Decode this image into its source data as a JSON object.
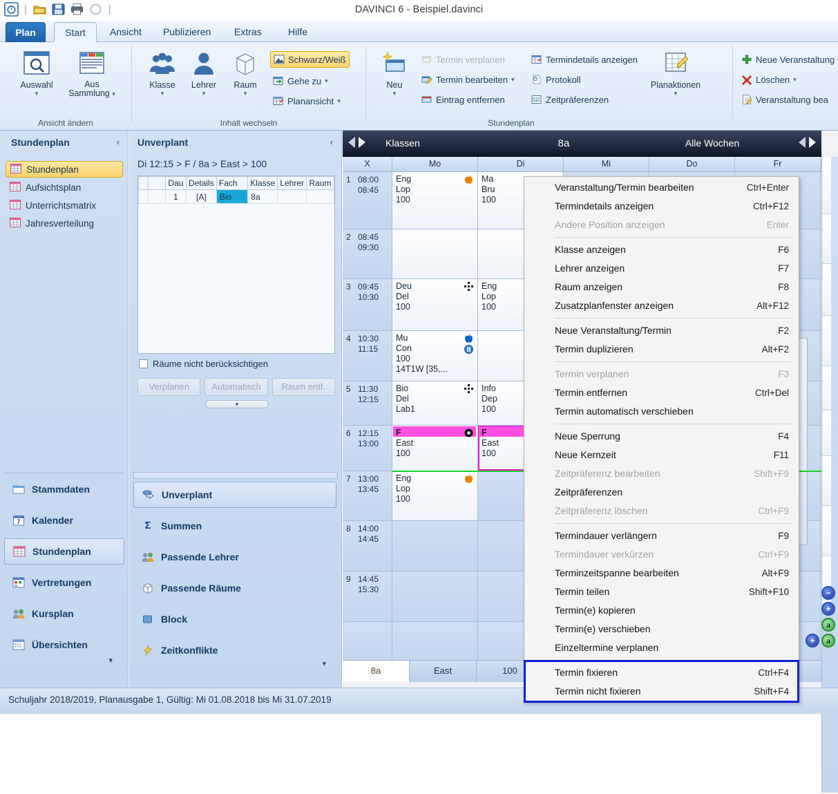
{
  "window": {
    "title": "DAVINCI 6 - Beispiel.davinci",
    "quick_access": [
      {
        "name": "app-icon",
        "icon": "davinci-logo-icon"
      },
      {
        "name": "open",
        "icon": "open-folder-icon"
      },
      {
        "name": "save",
        "icon": "save-disk-icon"
      },
      {
        "name": "print",
        "icon": "printer-icon"
      },
      {
        "name": "refresh",
        "icon": "refresh-icon"
      }
    ]
  },
  "ribbon": {
    "tabs": [
      {
        "label": "Plan",
        "state": "file"
      },
      {
        "label": "Start",
        "state": "active"
      },
      {
        "label": "Ansicht",
        "state": "normal"
      },
      {
        "label": "Publizieren",
        "state": "normal"
      },
      {
        "label": "Extras",
        "state": "normal"
      },
      {
        "label": "Hilfe",
        "state": "normal"
      }
    ],
    "groups": [
      {
        "label": "Ansicht ändern",
        "big_buttons": [
          {
            "label": "Auswahl",
            "icon": "magnifier-window-icon",
            "caret": "▾"
          },
          {
            "label": "Aus\nSammlung",
            "label_l1": "Aus",
            "label_l2": "Sammlung",
            "icon": "collection-table-icon",
            "caret": "▾"
          }
        ]
      },
      {
        "label": "Inhalt wechseln",
        "big_buttons": [
          {
            "label": "Klasse",
            "icon": "people-group-icon",
            "caret": "▾"
          },
          {
            "label": "Lehrer",
            "icon": "person-icon",
            "caret": "▾"
          },
          {
            "label": "Raum",
            "icon": "cube-icon",
            "caret": "▾"
          }
        ],
        "small_buttons": [
          {
            "label": "Schwarz/Weiß",
            "icon": "blackwhite-icon",
            "state": "highlight"
          },
          {
            "label": "Gehe zu",
            "icon": "goto-calendar-icon",
            "caret": "▾"
          },
          {
            "label": "Planansicht",
            "icon": "plan-view-icon",
            "caret": "▾"
          }
        ]
      },
      {
        "label": "Stundenplan",
        "big_buttons": [
          {
            "label": "Neu",
            "icon": "new-star-icon",
            "caret": "▾"
          },
          {
            "label": "Planaktionen",
            "icon": "plan-actions-icon",
            "caret": "▾"
          }
        ],
        "small_buttons": [
          {
            "label": "Termin verplanen",
            "icon": "schedule-appointment-icon",
            "state": "disabled"
          },
          {
            "label": "Termin bearbeiten",
            "icon": "edit-appointment-icon",
            "caret": "▾"
          },
          {
            "label": "Eintrag entfernen",
            "icon": "remove-entry-icon"
          },
          {
            "label": "Termindetails anzeigen",
            "icon": "appointment-details-icon"
          },
          {
            "label": "Protokoll",
            "icon": "protocol-icon"
          },
          {
            "label": "Zeitpräferenzen",
            "icon": "time-preferences-icon"
          }
        ]
      },
      {
        "label": "",
        "small_buttons": [
          {
            "label": "Neue Veranstaltung",
            "icon": "green-plus-icon"
          },
          {
            "label": "Löschen",
            "icon": "red-x-icon",
            "caret": "▾"
          },
          {
            "label": "Veranstaltung bea",
            "icon": "edit-event-icon"
          }
        ]
      }
    ]
  },
  "sidebar": {
    "title": "Stundenplan",
    "collapse_glyph": "‹",
    "items": [
      {
        "label": "Stundenplan",
        "icon": "grid-table-icon",
        "selected": true
      },
      {
        "label": "Aufsichtsplan",
        "icon": "grid-table-icon",
        "selected": false
      },
      {
        "label": "Unterrichtsmatrix",
        "icon": "grid-table-icon",
        "selected": false
      },
      {
        "label": "Jahresverteilung",
        "icon": "grid-table-icon",
        "selected": false
      }
    ],
    "modules": [
      {
        "label": "Stammdaten",
        "icon": "folder-icon",
        "selected": false
      },
      {
        "label": "Kalender",
        "icon": "calendar-icon",
        "selected": false
      },
      {
        "label": "Stundenplan",
        "icon": "grid-table-icon",
        "selected": true
      },
      {
        "label": "Vertretungen",
        "icon": "substitution-calendar-icon",
        "selected": false
      },
      {
        "label": "Kursplan",
        "icon": "people-group-icon",
        "selected": false
      },
      {
        "label": "Übersichten",
        "icon": "overview-grid-icon",
        "selected": false
      }
    ],
    "more_glyph": "▾"
  },
  "unplanned": {
    "title": "Unverplant",
    "collapse_glyph": "‹",
    "breadcrumb": "Di 12:15 > F / 8a > East > 100",
    "columns": [
      "",
      "",
      "Dau",
      "Details",
      "Fach",
      "Klasse",
      "Lehrer",
      "Raum"
    ],
    "rows": [
      {
        "cells": [
          "",
          "",
          "1",
          "[A]",
          "Bio",
          "8a",
          "",
          ""
        ],
        "selected_cell_index": 4
      }
    ],
    "checkbox": {
      "label": "Räume nicht berücksichtigen",
      "checked": false
    },
    "buttons": [
      {
        "label": "Verplanen",
        "enabled": false
      },
      {
        "label": "Automatisch",
        "enabled": false
      },
      {
        "label": "Raum entf.",
        "enabled": false
      }
    ],
    "splitter_glyph": "▾",
    "panels": [
      {
        "label": "Unverplant",
        "icon": "unplanned-arrow-icon",
        "selected": true
      },
      {
        "label": "Summen",
        "icon": "sigma-icon",
        "selected": false
      },
      {
        "label": "Passende Lehrer",
        "icon": "people-group-icon",
        "selected": false
      },
      {
        "label": "Passende Räume",
        "icon": "cube-icon",
        "selected": false
      },
      {
        "label": "Block",
        "icon": "block-square-icon",
        "selected": false
      },
      {
        "label": "Zeitkonflikte",
        "icon": "lightning-icon",
        "selected": false
      }
    ],
    "more_glyph": "▾"
  },
  "timetable": {
    "header": {
      "prev_glyph": "◀",
      "next_glyph": "▶",
      "scope_label": "Klassen",
      "object_label": "8a",
      "weeks_label": "Alle Wochen",
      "right_prev_glyph": "◀",
      "right_next_glyph": "▶"
    },
    "columns": [
      "X",
      "Mo",
      "Di",
      "Mi",
      "Do",
      "Fr"
    ],
    "periods": [
      {
        "num": "1",
        "start": "08:00",
        "end": "08:45"
      },
      {
        "num": "2",
        "start": "08:45",
        "end": "09:30"
      },
      {
        "num": "3",
        "start": "09:45",
        "end": "10:30"
      },
      {
        "num": "4",
        "start": "10:30",
        "end": "11:15"
      },
      {
        "num": "5",
        "start": "11:30",
        "end": "12:15"
      },
      {
        "num": "6",
        "start": "12:15",
        "end": "13:00"
      },
      {
        "num": "7",
        "start": "13:00",
        "end": "13:45"
      },
      {
        "num": "8",
        "start": "14:00",
        "end": "14:45"
      },
      {
        "num": "9",
        "start": "14:45",
        "end": "15:30"
      }
    ],
    "lessons": [
      {
        "period": 1,
        "day": "Mo",
        "subject": "Eng",
        "teacher": "Lop",
        "room": "100",
        "badge": "apple-orange-icon"
      },
      {
        "period": 1,
        "day": "Di",
        "subject": "Ma",
        "teacher": "Bru",
        "room": "100",
        "badge": ""
      },
      {
        "period": 3,
        "day": "Mo",
        "subject": "Deu",
        "teacher": "Del",
        "room": "100",
        "badge": "cluster-icon"
      },
      {
        "period": 3,
        "day": "Di",
        "subject": "Eng",
        "teacher": "Lop",
        "room": "100",
        "badge": ""
      },
      {
        "period": 4,
        "day": "Mo",
        "subject": "Mu",
        "teacher": "Con",
        "room": "100",
        "extra": "14T1W [35,...",
        "badge": "apple-blue-icon",
        "badge2": "pause-icon"
      },
      {
        "period": 5,
        "day": "Mo",
        "subject": "Bio",
        "teacher": "Del",
        "room": "Lab1",
        "badge": "cluster-icon"
      },
      {
        "period": 5,
        "day": "Di",
        "subject": "Info",
        "teacher": "Dep",
        "room": "100",
        "badge": ""
      },
      {
        "period": 6,
        "day": "Mo",
        "subject": "F",
        "teacher": "East",
        "room": "100",
        "badge": "fixed-circle-icon",
        "highlight": "pink"
      },
      {
        "period": 6,
        "day": "Di",
        "subject": "F",
        "teacher": "East",
        "room": "100",
        "badge": "",
        "highlight": "pink",
        "selected": true
      },
      {
        "period": 7,
        "day": "Mo",
        "subject": "Eng",
        "teacher": "Lop",
        "room": "100",
        "badge": "apple-orange-icon"
      }
    ],
    "bottom_tabs": [
      {
        "label": "8a",
        "active": true
      },
      {
        "label": "East",
        "active": false
      },
      {
        "label": "100",
        "active": false
      }
    ],
    "zoom_buttons": [
      {
        "name": "zoom-out-button",
        "glyph": "−",
        "color": "blue"
      },
      {
        "name": "zoom-in-button",
        "glyph": "+",
        "color": "blue"
      },
      {
        "name": "font-smaller-button",
        "glyph": "a",
        "color": "green"
      },
      {
        "name": "font-larger-button",
        "glyph": "a",
        "color": "green"
      },
      {
        "name": "expand-button",
        "glyph": "+",
        "color": "blue"
      }
    ]
  },
  "context_menu": {
    "items": [
      {
        "label": "Veranstaltung/Termin bearbeiten",
        "shortcut": "Ctrl+Enter",
        "enabled": true
      },
      {
        "label": "Termindetails anzeigen",
        "shortcut": "Ctrl+F12",
        "enabled": true
      },
      {
        "label": "Andere Position anzeigen",
        "shortcut": "Enter",
        "enabled": false
      },
      {
        "separator": true
      },
      {
        "label": "Klasse anzeigen",
        "shortcut": "F6",
        "enabled": true
      },
      {
        "label": "Lehrer anzeigen",
        "shortcut": "F7",
        "enabled": true
      },
      {
        "label": "Raum anzeigen",
        "shortcut": "F8",
        "enabled": true
      },
      {
        "label": "Zusatzplanfenster anzeigen",
        "shortcut": "Alt+F12",
        "enabled": true
      },
      {
        "separator": true
      },
      {
        "label": "Neue Veranstaltung/Termin",
        "shortcut": "F2",
        "enabled": true
      },
      {
        "label": "Termin duplizieren",
        "shortcut": "Alt+F2",
        "enabled": true
      },
      {
        "separator": true
      },
      {
        "label": "Termin verplanen",
        "shortcut": "F3",
        "enabled": false
      },
      {
        "label": "Termin entfernen",
        "shortcut": "Ctrl+Del",
        "enabled": true
      },
      {
        "label": "Termin automatisch verschieben",
        "shortcut": "",
        "enabled": true
      },
      {
        "separator": true
      },
      {
        "label": "Neue Sperrung",
        "shortcut": "F4",
        "enabled": true
      },
      {
        "label": "Neue Kernzeit",
        "shortcut": "F11",
        "enabled": true
      },
      {
        "label": "Zeitpräferenz bearbeiten",
        "shortcut": "Shift+F9",
        "enabled": false
      },
      {
        "label": "Zeitpräferenzen",
        "shortcut": "",
        "enabled": true
      },
      {
        "label": "Zeitpräferenz löschen",
        "shortcut": "Ctrl+F9",
        "enabled": false
      },
      {
        "separator": true
      },
      {
        "label": "Termindauer verlängern",
        "shortcut": "F9",
        "enabled": true
      },
      {
        "label": "Termindauer verkürzen",
        "shortcut": "Ctrl+F9",
        "enabled": false
      },
      {
        "label": "Terminzeitspanne bearbeiten",
        "shortcut": "Alt+F9",
        "enabled": true
      },
      {
        "label": "Termin teilen",
        "shortcut": "Shift+F10",
        "enabled": true
      },
      {
        "label": "Termin(e) kopieren",
        "shortcut": "",
        "enabled": true
      },
      {
        "label": "Termin(e) verschieben",
        "shortcut": "",
        "enabled": true
      },
      {
        "label": "Einzeltermine verplanen",
        "shortcut": "",
        "enabled": true
      },
      {
        "separator": true
      },
      {
        "label": "Termin fixieren",
        "shortcut": "Ctrl+F4",
        "enabled": true,
        "highlighted": true
      },
      {
        "label": "Termin nicht fixieren",
        "shortcut": "Shift+F4",
        "enabled": true,
        "highlighted": true
      }
    ],
    "highlight_color": "#1020d8"
  },
  "statusbar": {
    "text": "Schuljahr 2018/2019, Planausgabe 1, Gültig: Mi 01.08.2018 bis Mi 31.07.2019"
  }
}
